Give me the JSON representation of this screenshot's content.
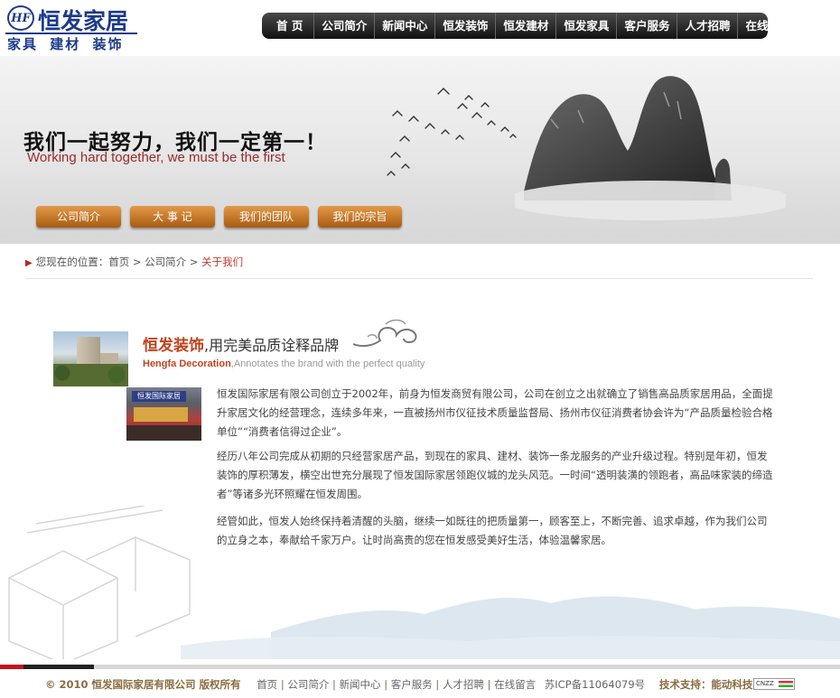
{
  "header": {
    "logo_mark": "HF",
    "logo_name": "恒发家居",
    "logo_sub": "家具 建材 装饰"
  },
  "nav": {
    "items": [
      "首 页",
      "公司简介",
      "新闻中心",
      "恒发装饰",
      "恒发建材",
      "恒发家具",
      "客户服务",
      "人才招聘",
      "在线留言"
    ]
  },
  "banner": {
    "slogan_cn": "我们一起努力，我们一定第一！",
    "slogan_en": "Working hard together, we must be the first",
    "buttons": [
      "公司简介",
      "大 事 记",
      "我们的团队",
      "我们的宗旨"
    ]
  },
  "breadcrumb": {
    "prefix": "您现在的位置：",
    "home": "首页",
    "sep": " > ",
    "section": "公司简介",
    "current": "关于我们"
  },
  "content": {
    "title_brand": "恒发装饰",
    "title_rest": ",用完美品质诠释品牌",
    "title_en_brand": "Hengfa Decoration",
    "title_en_rest": ",Annotates the brand with the perfect quality",
    "store_sign": "恒发国际家居",
    "paragraphs": [
      "恒发国际家居有限公司创立于2002年，前身为恒发商贸有限公司，公司在创立之出就确立了销售高品质家居用品，全面提升家居文化的经营理念，连续多年来，一直被扬州市仪征技术质量监督局、扬州市仪征消费者协会许为“产品质量检验合格单位”“消费者信得过企业”。",
      "经历八年公司完成从初期的只经营家居产品，到现在的家具、建材、装饰一条龙服务的产业升级过程。特别是年初，恒发装饰的厚积薄发，横空出世充分展现了恒发国际家居领跑仪城的龙头风范。一时间“透明装潢的领跑者，高品味家装的缔造者”等诸多光环照耀在恒发周围。",
      "经管如此，恒发人始终保持着清醒的头脑，继续一如既往的把质量第一，顾客至上，不断完善、追求卓越，作为我们公司的立身之本，奉献给千家万户。让时尚高贵的您在恒发感受美好生活，体验温馨家居。"
    ]
  },
  "footer": {
    "copyright": "© 2010 恒发国际家居有限公司 版权所有",
    "links": [
      "首页",
      "公司简介",
      "新闻中心",
      "客户服务",
      "人才招聘",
      "在线留言"
    ],
    "icp": "苏ICP备11064079号",
    "tech": "技术支持：能动科技",
    "cnzz": "CNZZ"
  },
  "colors": {
    "brand_blue": "#1b3a8a",
    "accent_red": "#c2421d",
    "button_orange": "#c9782a",
    "nav_dark": "#222222"
  }
}
